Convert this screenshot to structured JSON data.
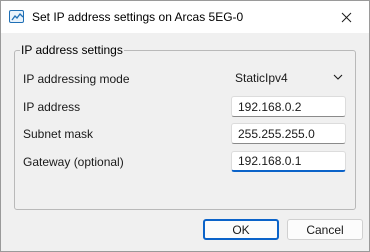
{
  "window": {
    "title": "Set IP address settings on Arcas 5EG-0"
  },
  "group": {
    "legend": "IP address settings"
  },
  "fields": {
    "mode": {
      "label": "IP addressing mode",
      "value": "StaticIpv4"
    },
    "ip": {
      "label": "IP address",
      "value": "192.168.0.2"
    },
    "subnet": {
      "label": "Subnet mask",
      "value": "255.255.255.0"
    },
    "gateway": {
      "label": "Gateway (optional)",
      "value": "192.168.0.1"
    }
  },
  "buttons": {
    "ok": "OK",
    "cancel": "Cancel"
  },
  "icons": {
    "app": "network-settings-icon",
    "close": "close-icon",
    "dropdown": "chevron-down-icon"
  },
  "colors": {
    "accent": "#0b63c9",
    "background": "#f0f0f0"
  }
}
